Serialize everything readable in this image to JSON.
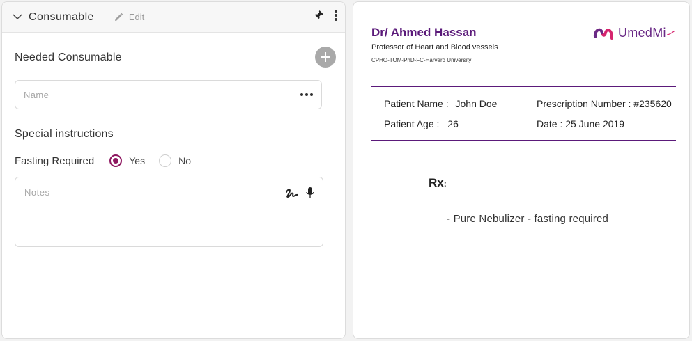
{
  "left": {
    "header": {
      "title": "Consumable",
      "edit_label": "Edit"
    },
    "needed_title": "Needed Consumable",
    "name_placeholder": "Name",
    "special_title": "Special instructions",
    "fasting": {
      "label": "Fasting Required",
      "options": [
        "Yes",
        "No"
      ],
      "selected": "Yes"
    },
    "notes_placeholder": "Notes"
  },
  "prescription": {
    "doctor_name": "Dr/ Ahmed Hassan",
    "doctor_title": "Professor of Heart and Blood vessels",
    "doctor_credentials": "CPHO-TOM-PhD-FC-Harverd University",
    "logo_text": "UmedMi",
    "patient_name_label": "Patient Name :",
    "patient_name": "John Doe",
    "patient_age_label": "Patient Age :",
    "patient_age": "26",
    "prescription_number": "Prescription Number : #235620",
    "date": "Date : 25 June 2019",
    "rx_label": "Rx",
    "rx_colon": ":",
    "items": [
      "-  Pure Nebulizer - fasting  required"
    ]
  },
  "colors": {
    "accent": "#8e1760",
    "brand_purple": "#5b1a7a",
    "logo_pink": "#d6246e"
  }
}
